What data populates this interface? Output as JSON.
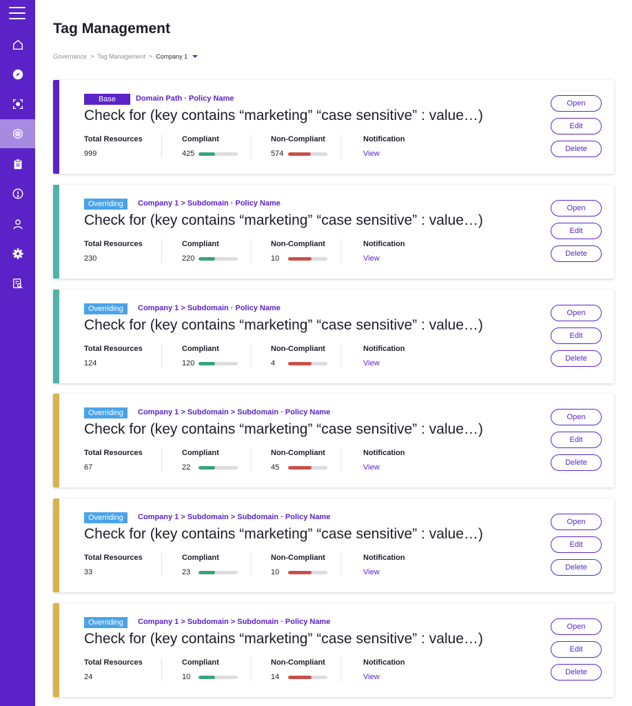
{
  "page": {
    "title": "Tag Management"
  },
  "breadcrumb": [
    "Governance",
    "Tag Management",
    "Company 1"
  ],
  "labels": {
    "total_resources": "Total Resources",
    "compliant": "Compliant",
    "non_compliant": "Non-Compliant",
    "notification": "Notification",
    "view": "View",
    "open": "Open",
    "edit": "Edit",
    "delete": "Delete"
  },
  "colors": {
    "brand": "#5b22c8",
    "base_tag": "#5b22c8",
    "override_tag": "#4aa3e8",
    "teal_bar": "#4fb3a9",
    "gold_bar": "#d9b24e",
    "compliant": "#3aa37a",
    "noncompliant": "#c9504a"
  },
  "policies": [
    {
      "tag": "Base",
      "path": "Domain Path · Policy Name",
      "check": "Check for (key contains “marketing” “case sensitive” : value…)",
      "total": "999",
      "compliant": "425",
      "non_compliant": "574",
      "compliant_frac": 0.425,
      "noncompliant_frac": 0.574
    },
    {
      "tag": "Overriding",
      "path": "Company 1 > Subdomain · Policy Name",
      "check": "Check for (key contains “marketing” “case sensitive” : value…)",
      "total": "230",
      "compliant": "220",
      "non_compliant": "10",
      "compliant_frac": 0.42,
      "noncompliant_frac": 0.6
    },
    {
      "tag": "Overriding",
      "path": "Company 1 > Subdomain · Policy Name",
      "check": "Check for (key contains “marketing” “case sensitive” : value…)",
      "total": "124",
      "compliant": "120",
      "non_compliant": "4",
      "compliant_frac": 0.42,
      "noncompliant_frac": 0.6
    },
    {
      "tag": "Overriding",
      "path": "Company 1 > Subdomain > Subdomain · Policy Name",
      "check": "Check for (key contains “marketing” “case sensitive” : value…)",
      "total": "67",
      "compliant": "22",
      "non_compliant": "45",
      "compliant_frac": 0.42,
      "noncompliant_frac": 0.6
    },
    {
      "tag": "Overriding",
      "path": "Company 1 > Subdomain > Subdomain · Policy Name",
      "check": "Check for (key contains “marketing” “case sensitive” : value…)",
      "total": "33",
      "compliant": "23",
      "non_compliant": "10",
      "compliant_frac": 0.42,
      "noncompliant_frac": 0.6
    },
    {
      "tag": "Overriding",
      "path": "Company 1 > Subdomain > Subdomain · Policy Name",
      "check": "Check for (key contains “marketing” “case sensitive” : value…)",
      "total": "24",
      "compliant": "10",
      "non_compliant": "14",
      "compliant_frac": 0.42,
      "noncompliant_frac": 0.6
    }
  ],
  "sidebar": {
    "icons": [
      "menu-icon",
      "home-icon",
      "compass-icon",
      "scan-icon",
      "target-icon",
      "clipboard-icon",
      "alert-icon",
      "user-icon",
      "gear-icon",
      "report-search-icon"
    ]
  }
}
